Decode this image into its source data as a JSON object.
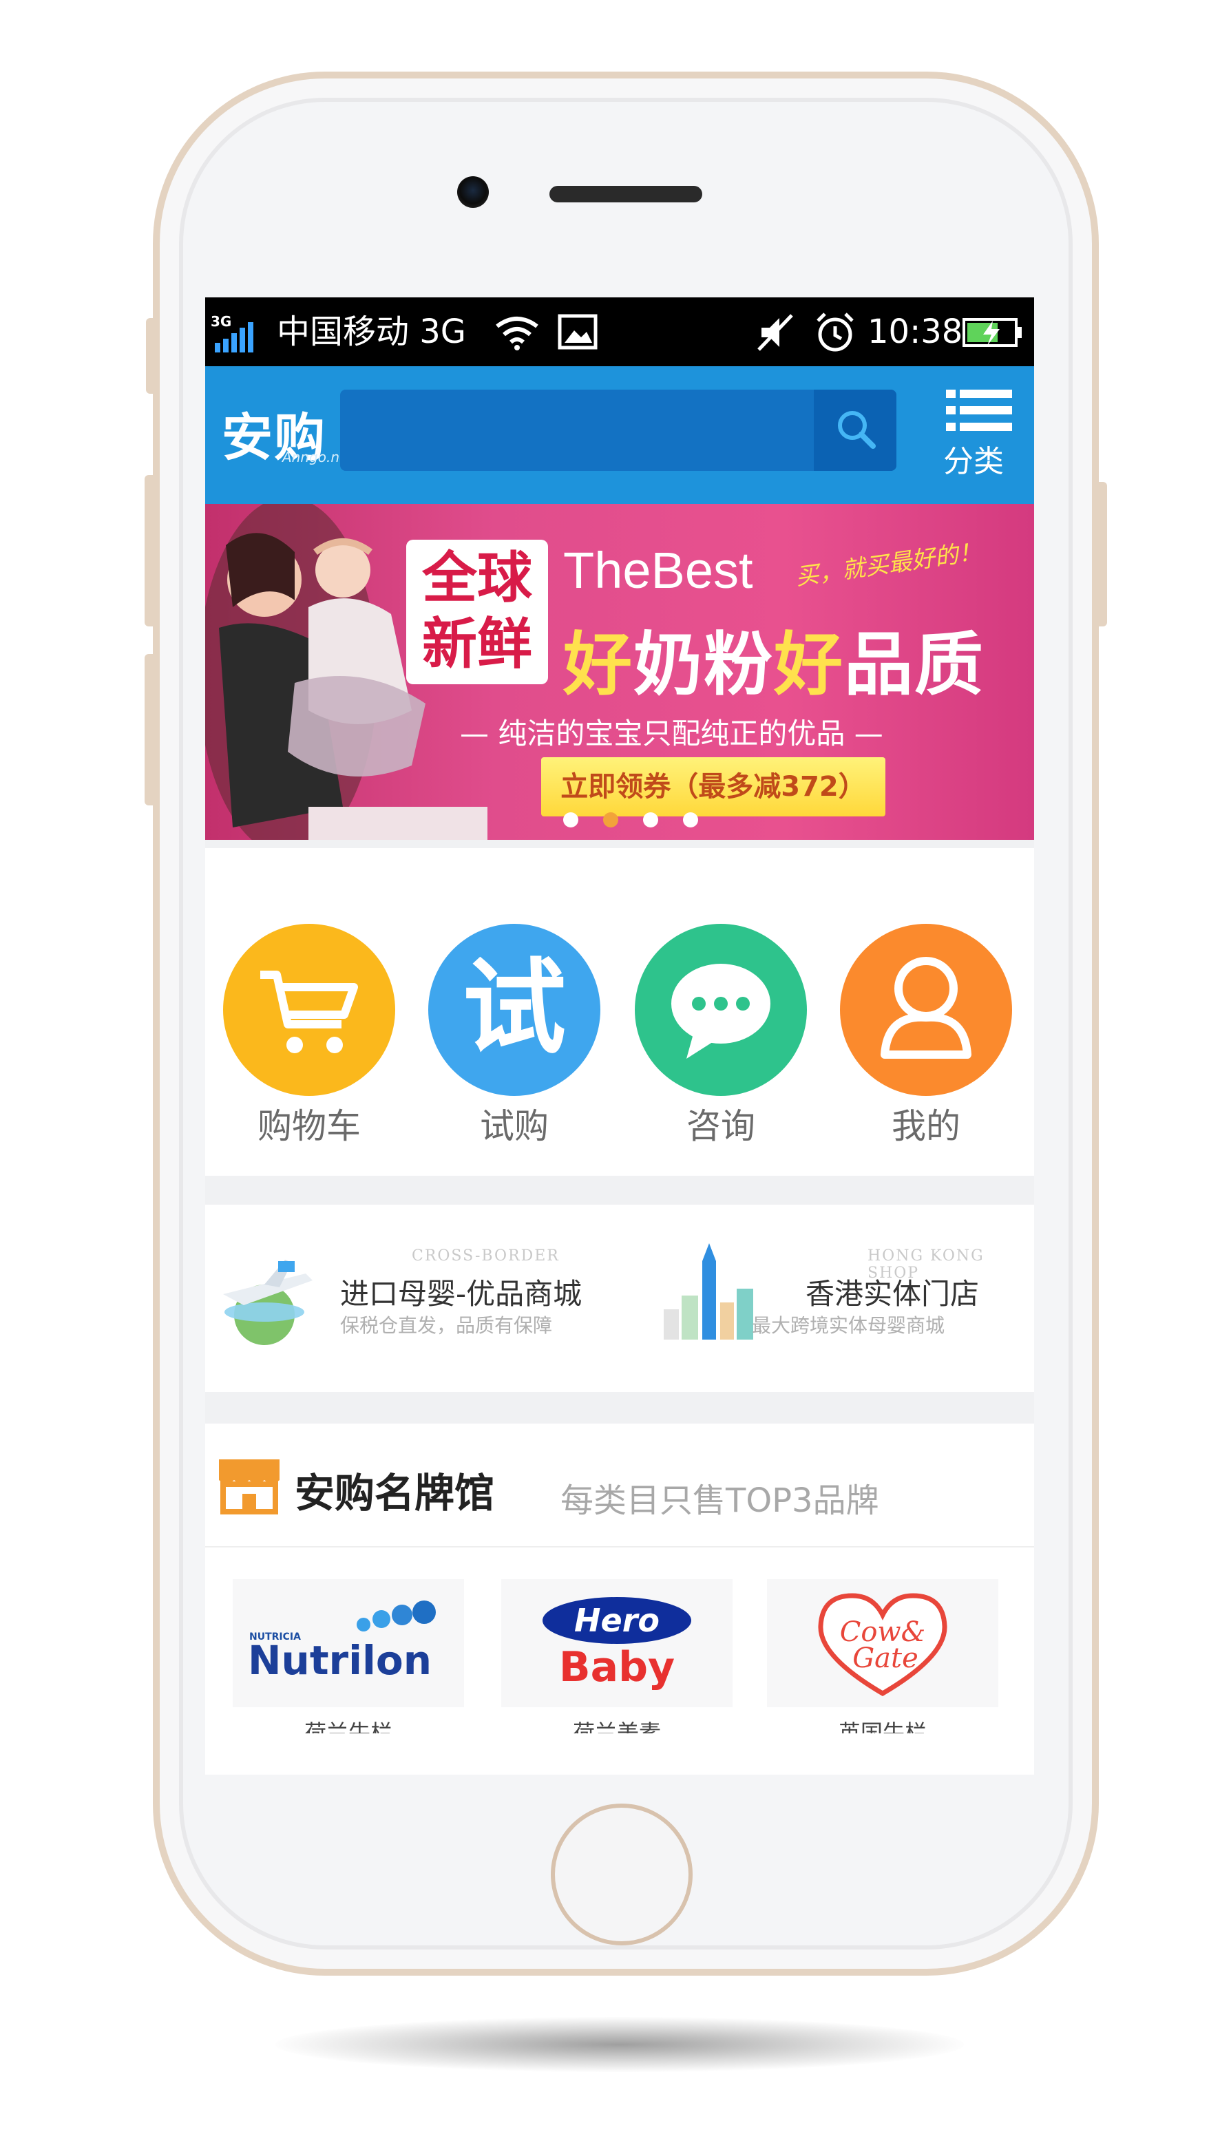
{
  "status_bar": {
    "network_badge": "3G",
    "carrier": "中国移动 3G",
    "time": "10:38"
  },
  "header": {
    "logo_text": "安购",
    "logo_sub": "Anngo.net",
    "search_value": "",
    "category_label": "分类"
  },
  "banner": {
    "badge_line1": "全球",
    "badge_line2": "新鲜",
    "title_en": "TheBest",
    "script_text": "买，就买最好的！",
    "headline_a": "好",
    "headline_b": "奶粉",
    "headline_c": "好",
    "headline_d": "品质",
    "tagline": "— 纯洁的宝宝只配纯正的优品 —",
    "cta": "立即领券（最多减372）",
    "slide_count": 4,
    "active_slide": 2
  },
  "quick_actions": [
    {
      "label": "购物车",
      "icon": "cart-icon",
      "color": "#fbb81c"
    },
    {
      "label": "试购",
      "icon": "trial-icon",
      "color": "#3fa6ee",
      "glyph": "试"
    },
    {
      "label": "咨询",
      "icon": "chat-icon",
      "color": "#2ec38c"
    },
    {
      "label": "我的",
      "icon": "user-icon",
      "color": "#fb8a2d"
    }
  ],
  "promos": [
    {
      "en": "CROSS-BORDER",
      "title": "进口母婴-优品商城",
      "subtitle": "保税仓直发，品质有保障"
    },
    {
      "en": "HONG KONG SHOP",
      "title": "香港实体门店",
      "subtitle": "最大跨境实体母婴商城"
    }
  ],
  "brands": {
    "title": "安购名牌馆",
    "subtitle": "每类目只售TOP3品牌",
    "items": [
      {
        "logo_top": "NUTRICIA",
        "logo": "Nutrilon",
        "name": "荷兰牛栏"
      },
      {
        "logo": "Hero",
        "logo2": "Baby",
        "name": "荷兰美素"
      },
      {
        "logo": "Cow&",
        "logo2": "Gate",
        "name": "英国牛栏"
      }
    ]
  },
  "colors": {
    "header_blue": "#1e93db",
    "search_blue": "#1372c3",
    "banner_pink": "#e04d8c",
    "phone_frame": "#e4d3c1"
  }
}
